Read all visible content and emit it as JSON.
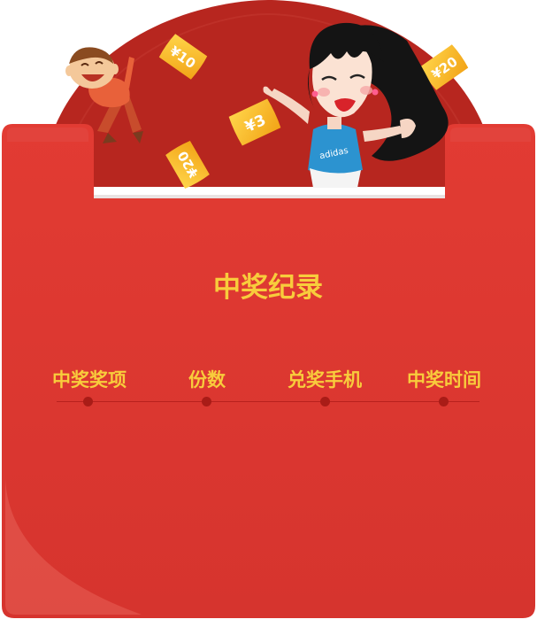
{
  "card": {
    "title": "中奖纪录"
  },
  "table": {
    "columns": [
      "中奖奖项",
      "份数",
      "兑奖手机",
      "中奖时间"
    ],
    "rows": []
  },
  "decor": {
    "coupons": [
      "¥10",
      "¥3",
      "¥20",
      "¥20"
    ],
    "shirt_brand": "adidas"
  },
  "colors": {
    "panel_red": "#d93731",
    "dome_red": "#b7261f",
    "gold_text": "#f8cc3c",
    "timeline": "#b8211d"
  }
}
